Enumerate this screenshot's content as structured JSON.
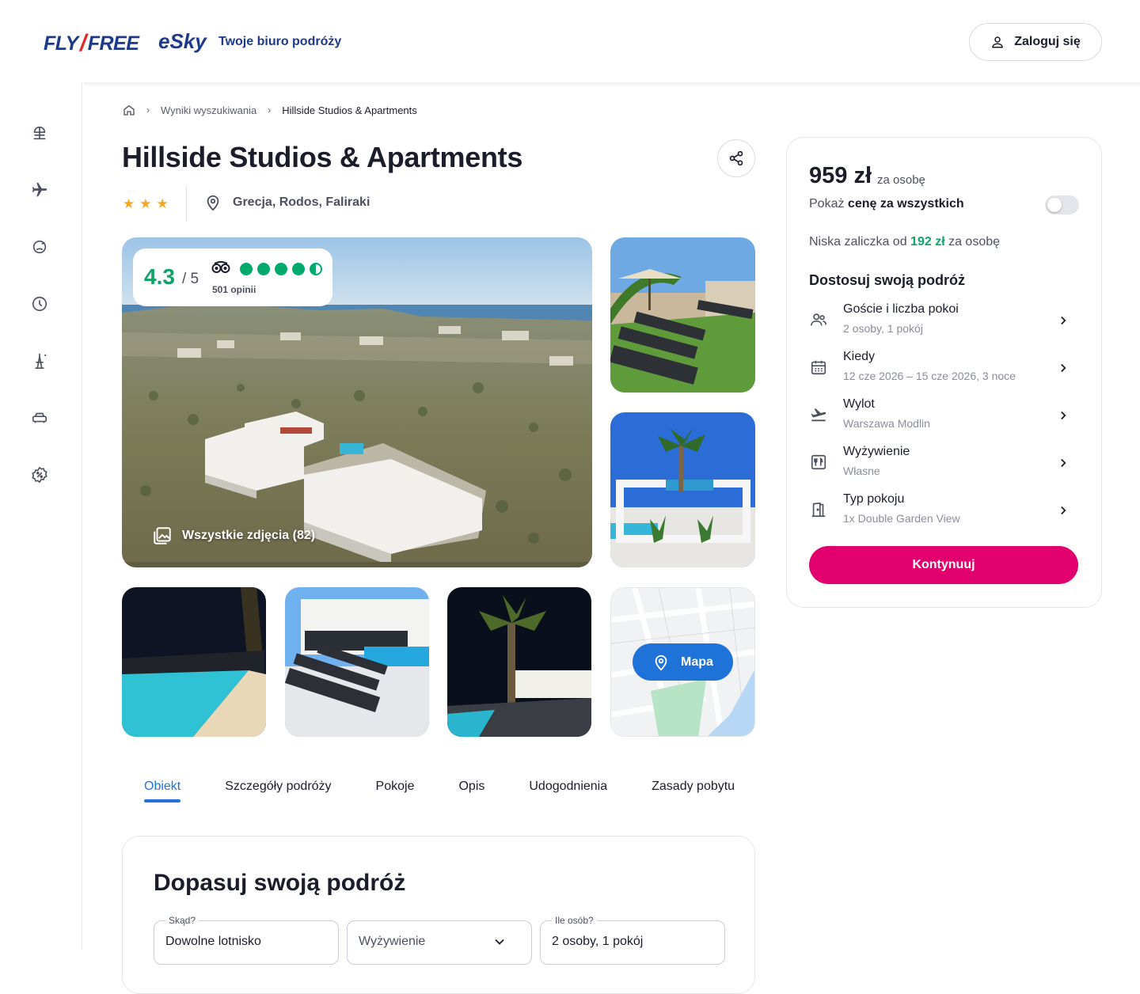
{
  "header": {
    "logo_fly": "FLY",
    "logo_free": "FREE",
    "logo_esky": "eSky",
    "tagline": "Twoje biuro podróży",
    "login_label": "Zaloguj się"
  },
  "sidebar": {
    "items": [
      {
        "icon": "beach-umbrella-icon"
      },
      {
        "icon": "airplane-icon"
      },
      {
        "icon": "island-icon"
      },
      {
        "icon": "clock-icon"
      },
      {
        "icon": "eiffel-tower-icon"
      },
      {
        "icon": "car-icon"
      },
      {
        "icon": "discount-badge-icon"
      }
    ]
  },
  "breadcrumb": {
    "home_icon": "home-icon",
    "items": [
      "Wyniki wyszukiwania",
      "Hillside Studios & Apartments"
    ]
  },
  "hotel": {
    "name": "Hillside Studios & Apartments",
    "stars": 3,
    "location": "Grecja, Rodos, Faliraki",
    "rating": "4.3",
    "rating_of": "/ 5",
    "reviews": "501 opinii",
    "tripadvisor_bubbles": 4.5,
    "all_photos": "Wszystkie zdjęcia (82)",
    "map_label": "Mapa"
  },
  "tabs": [
    "Obiekt",
    "Szczegóły podróży",
    "Pokoje",
    "Opis",
    "Udogodnienia",
    "Zasady pobytu"
  ],
  "fit": {
    "title": "Dopasuj swoją podróż",
    "from_label": "Skąd?",
    "from_value": "Dowolne lotnisko",
    "board_placeholder": "Wyżywienie",
    "people_label": "Ile osób?",
    "people_value": "2 osoby, 1 pokój"
  },
  "price_card": {
    "price": "959 zł",
    "per": "za osobę",
    "show_all_prefix": "Pokaż ",
    "show_all_bold": "cenę za wszystkich",
    "toggle_on": false,
    "deposit_prefix": "Niska zaliczka od ",
    "deposit_amount": "192 zł",
    "deposit_suffix": " za osobę",
    "customize_title": "Dostosuj swoją podróż",
    "options": [
      {
        "icon": "people-icon",
        "title": "Goście i liczba pokoi",
        "sub": "2 osoby, 1 pokój"
      },
      {
        "icon": "calendar-icon",
        "title": "Kiedy",
        "sub": "12 cze 2026 – 15 cze 2026, 3 noce"
      },
      {
        "icon": "departure-icon",
        "title": "Wylot",
        "sub": "Warszawa Modlin"
      },
      {
        "icon": "fork-knife-icon",
        "title": "Wyżywienie",
        "sub": "Własne"
      },
      {
        "icon": "door-icon",
        "title": "Typ pokoju",
        "sub": "1x Double Garden View"
      }
    ],
    "continue_label": "Kontynuuj"
  },
  "colors": {
    "brand_blue": "#1d3a8a",
    "accent_blue": "#1e72d8",
    "cta_pink": "#e2006f",
    "rating_green": "#12a167",
    "star_gold": "#f5a623"
  }
}
